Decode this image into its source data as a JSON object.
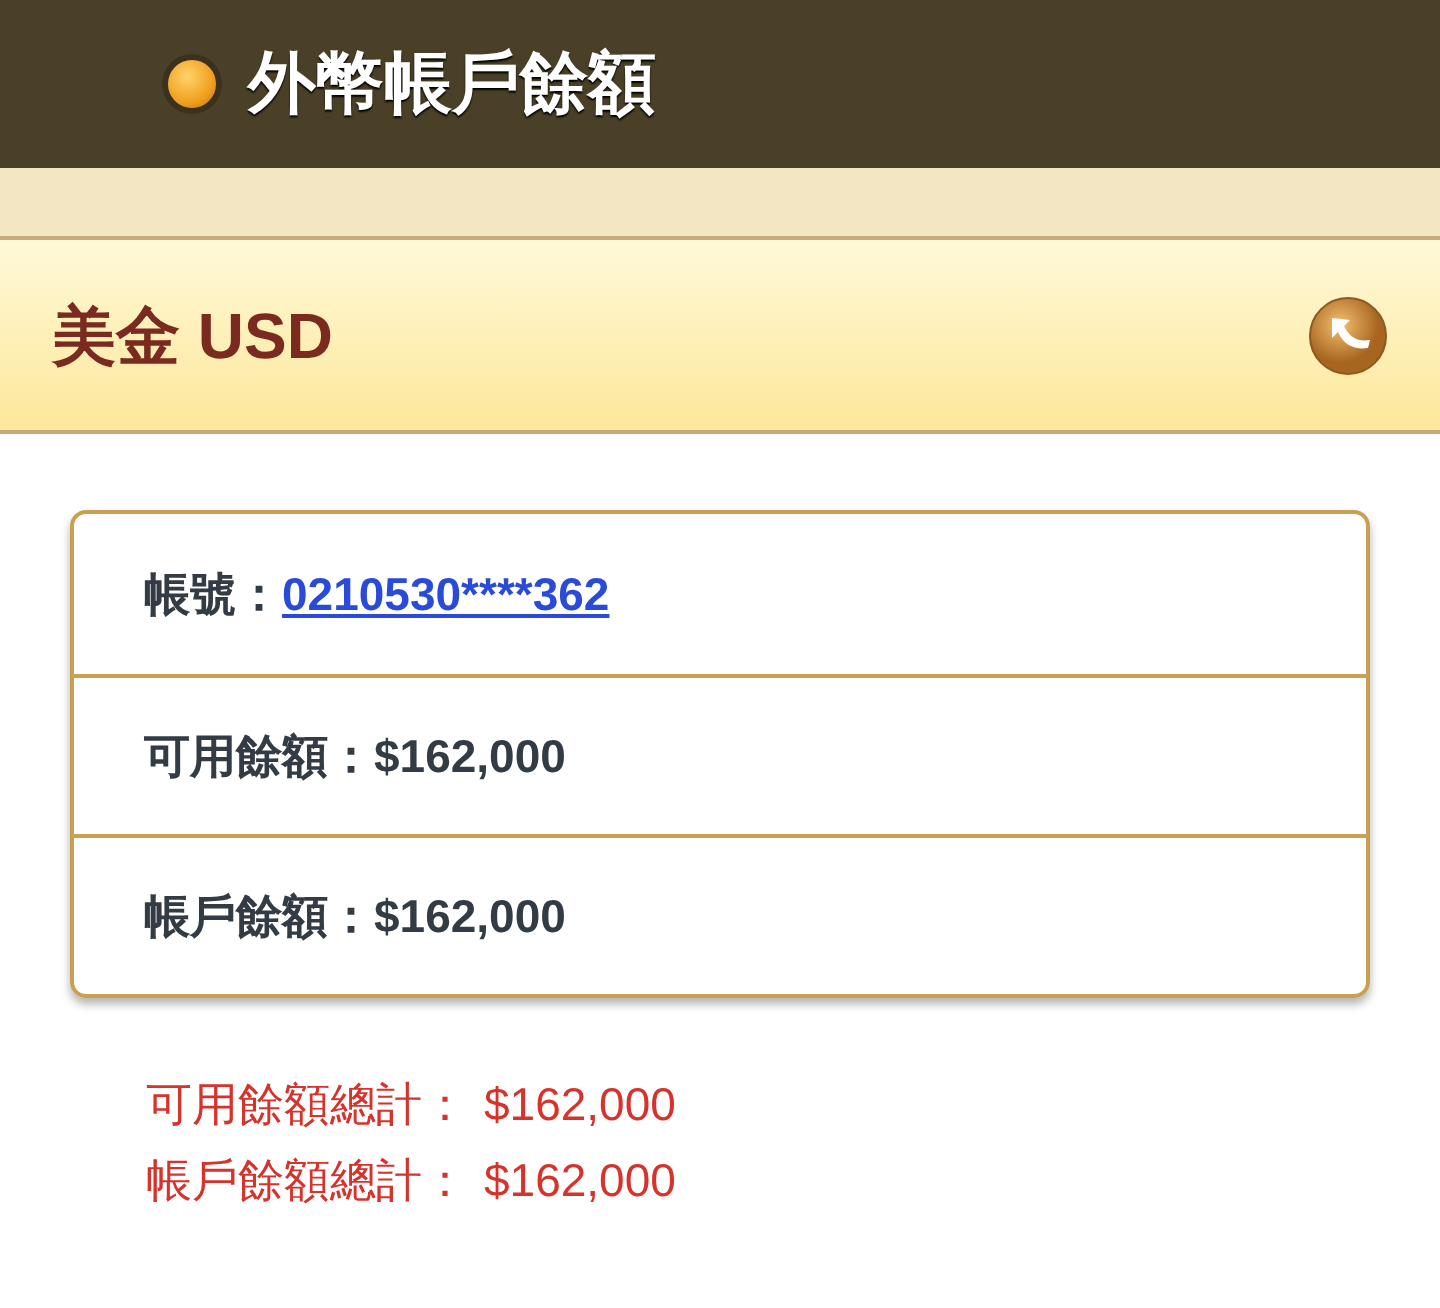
{
  "header": {
    "title": "外幣帳戶餘額"
  },
  "currency_bar": {
    "title": "美金 USD"
  },
  "account_rows": [
    {
      "label": "帳號：",
      "value": "0210530****362",
      "kind": "link"
    },
    {
      "label": "可用餘額：",
      "value": "$162,000",
      "kind": "text"
    },
    {
      "label": "帳戶餘額：",
      "value": "$162,000",
      "kind": "text"
    }
  ],
  "totals": [
    {
      "label": "可用餘額總計：",
      "value": "$162,000"
    },
    {
      "label": "帳戶餘額總計：",
      "value": "$162,000"
    }
  ]
}
